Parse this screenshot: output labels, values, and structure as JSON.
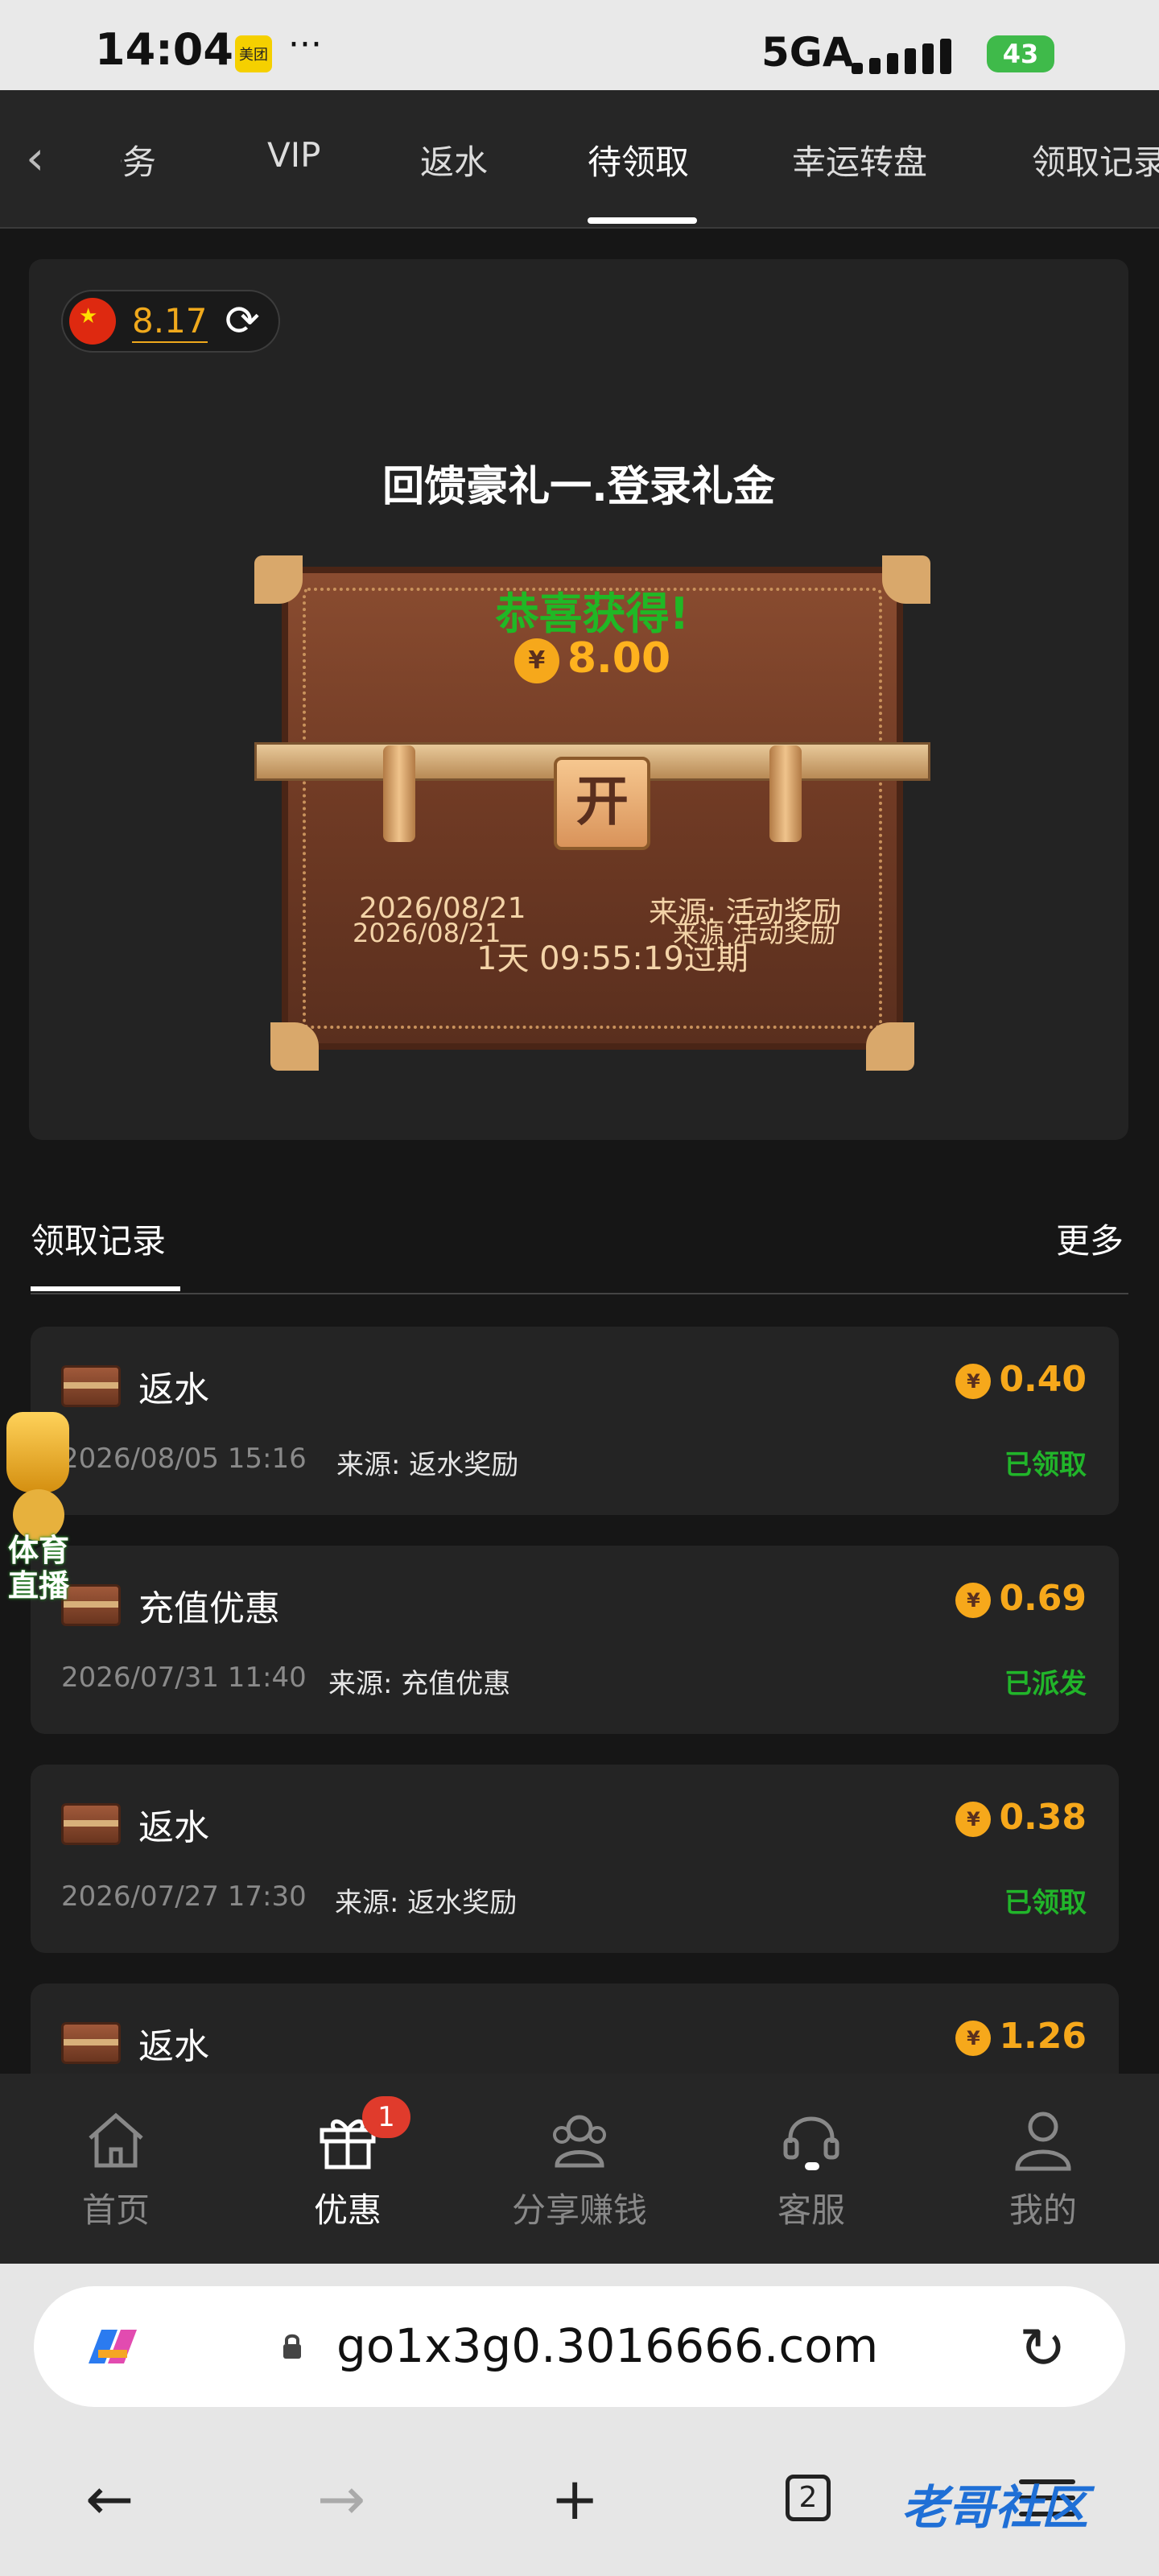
{
  "status_bar": {
    "time": "14:04",
    "app_badge": "美团",
    "dots": "···",
    "network": "5GA",
    "battery": "43"
  },
  "tabs": [
    {
      "label": "任务"
    },
    {
      "label": "VIP"
    },
    {
      "label": "返水"
    },
    {
      "label": "待领取"
    },
    {
      "label": "幸运转盘"
    },
    {
      "label": "领取记录"
    }
  ],
  "active_tab": "待领取",
  "balance": "8.17",
  "gift": {
    "title": "回馈豪礼一.登录礼金",
    "congrats": "恭喜获得!",
    "coin_symbol": "¥",
    "amount": "8.00",
    "lock_label": "开",
    "date1": "2026/08/21",
    "date2": "2026/08/21",
    "source1": "来源: 活动奖励",
    "source2": "来源 活动奖励",
    "expiry": "1天 09:55:19过期"
  },
  "records_section": {
    "title": "领取记录",
    "more": "更多"
  },
  "records": [
    {
      "type": "返水",
      "amount": "0.40",
      "time": "2026/08/05 15:16",
      "source": "来源: 返水奖励",
      "status": "已领取"
    },
    {
      "type": "充值优惠",
      "amount": "0.69",
      "time": "2026/07/31 11:40",
      "source": "来源: 充值优惠",
      "status": "已派发"
    },
    {
      "type": "返水",
      "amount": "0.38",
      "time": "2026/07/27 17:30",
      "source": "来源: 返水奖励",
      "status": "已领取"
    },
    {
      "type": "返水",
      "amount": "1.26",
      "time": "",
      "source": "",
      "status": ""
    }
  ],
  "float_badge": {
    "line1": "体育",
    "line2": "直播"
  },
  "bottom_nav": [
    {
      "label": "首页",
      "icon": "home-icon"
    },
    {
      "label": "优惠",
      "icon": "gift-icon",
      "badge": "1"
    },
    {
      "label": "分享赚钱",
      "icon": "share-icon"
    },
    {
      "label": "客服",
      "icon": "headset-icon"
    },
    {
      "label": "我的",
      "icon": "user-icon"
    }
  ],
  "browser": {
    "url": "go1x3g0.3016666.com",
    "tab_count": "2",
    "watermark": "老哥社区"
  },
  "colors": {
    "accent": "#f6a81b",
    "success": "#21b52a",
    "bg": "#161616",
    "card": "#242424"
  }
}
